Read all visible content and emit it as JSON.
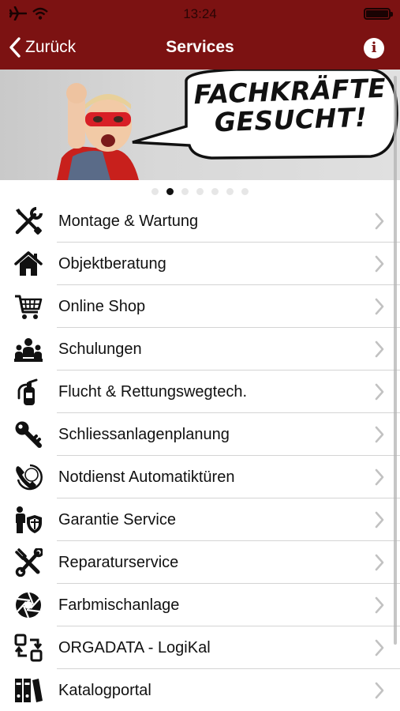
{
  "status_bar": {
    "time": "13:24"
  },
  "nav": {
    "back_label": "Zurück",
    "title": "Services",
    "info_glyph": "i"
  },
  "banner": {
    "line1": "FACHKRÄFTE",
    "line2": "GESUCHT!",
    "page_count": 7,
    "active_page": 2
  },
  "colors": {
    "header": "#7c1212",
    "text": "#111111",
    "separator": "#d4d4d4",
    "chevron": "#c2c2c2"
  },
  "items": [
    {
      "label": "Montage & Wartung",
      "icon": "tools-icon"
    },
    {
      "label": "Objektberatung",
      "icon": "house-icon"
    },
    {
      "label": "Online Shop",
      "icon": "cart-icon"
    },
    {
      "label": "Schulungen",
      "icon": "people-icon"
    },
    {
      "label": "Flucht & Rettungswegtech.",
      "icon": "fire-extinguisher-icon"
    },
    {
      "label": "Schliessanlagenplanung",
      "icon": "key-icon"
    },
    {
      "label": "Notdienst Automatiktüren",
      "icon": "phone-24h-icon"
    },
    {
      "label": "Garantie Service",
      "icon": "person-shield-icon"
    },
    {
      "label": "Reparaturservice",
      "icon": "wrench-screwdriver-icon"
    },
    {
      "label": "Farbmischanlage",
      "icon": "aperture-icon"
    },
    {
      "label": "ORGADATA - LogiKal",
      "icon": "convert-arrows-icon"
    },
    {
      "label": "Katalogportal",
      "icon": "binders-icon"
    }
  ]
}
